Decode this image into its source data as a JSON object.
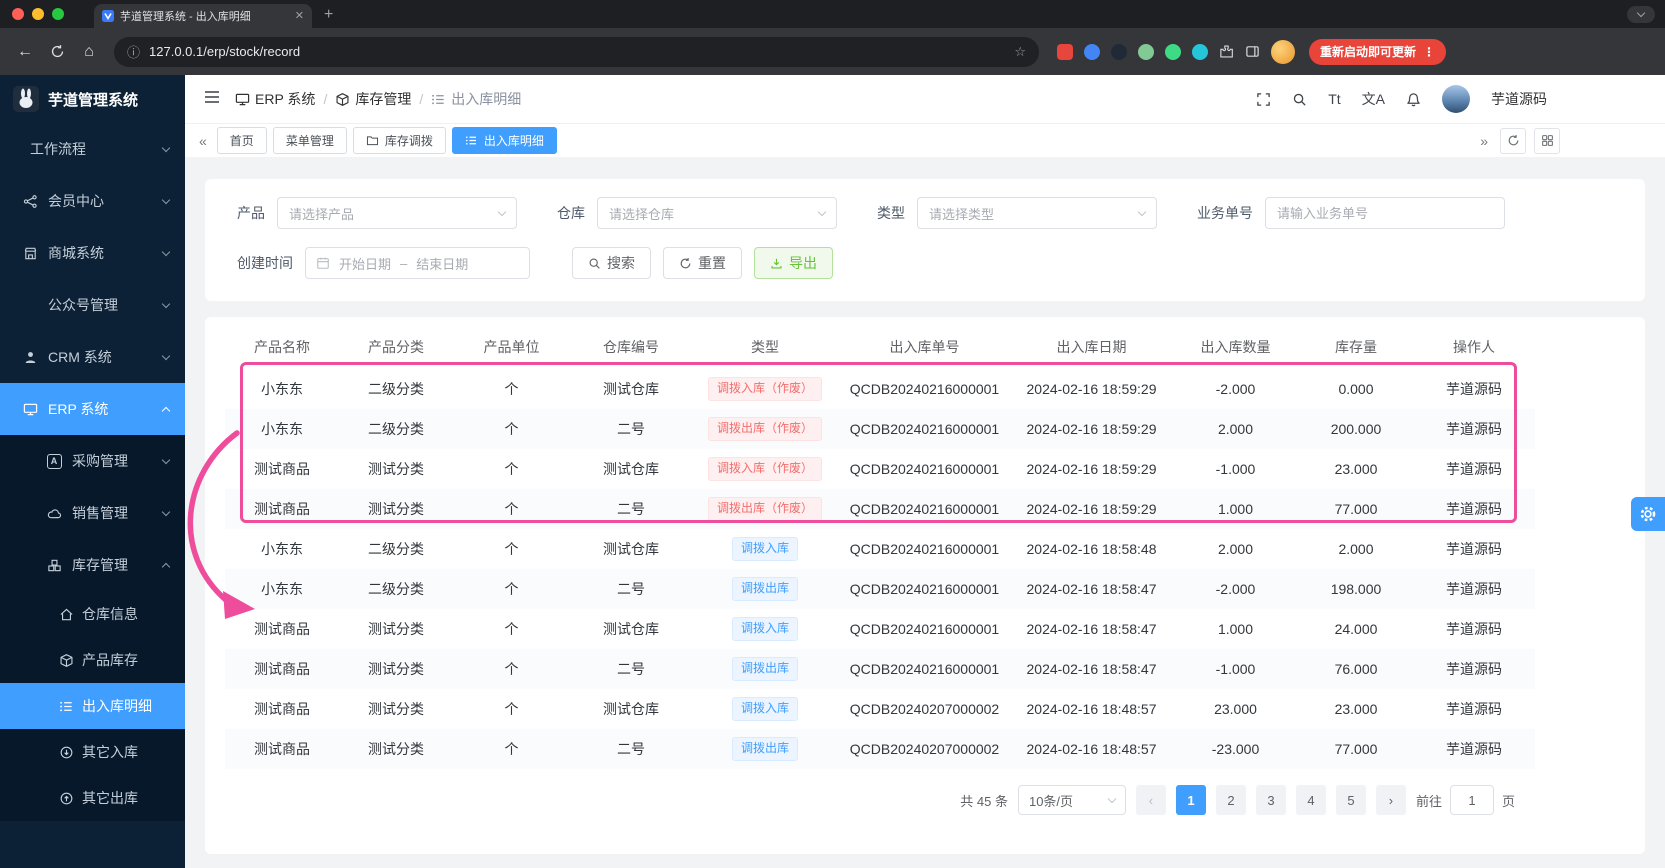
{
  "colors": {
    "primary": "#409eff",
    "danger": "#f56c6c",
    "success": "#67c23a",
    "annotation_pink": "#ee4d9b",
    "sidebar_bg": "#0c2135"
  },
  "browser": {
    "tab_title": "芋道管理系统 - 出入库明细",
    "url": "127.0.0.1/erp/stock/record",
    "update_button": "重新启动即可更新"
  },
  "icons": {
    "collapse": "«",
    "expand": "»",
    "more": "⋮",
    "close": "✕",
    "new_tab": "+",
    "back": "←",
    "home": "⌂",
    "info": "ⓘ",
    "star": "☆",
    "slash": "/",
    "purchase_a": "A"
  },
  "sidebar": {
    "app_title": "芋道管理系统",
    "items": [
      {
        "label": "工作流程"
      },
      {
        "label": "会员中心"
      },
      {
        "label": "商城系统"
      },
      {
        "label": "公众号管理"
      },
      {
        "label": "CRM 系统"
      },
      {
        "label": "ERP 系统"
      },
      {
        "label": "采购管理"
      },
      {
        "label": "销售管理"
      },
      {
        "label": "库存管理"
      },
      {
        "label": "仓库信息"
      },
      {
        "label": "产品库存"
      },
      {
        "label": "出入库明细"
      },
      {
        "label": "其它入库"
      },
      {
        "label": "其它出库"
      }
    ]
  },
  "header": {
    "breadcrumb": [
      {
        "label": "ERP 系统"
      },
      {
        "label": "库存管理"
      },
      {
        "label": "出入库明细"
      }
    ],
    "font_size_icon_text": "Tt",
    "translate_icon_text": "文A",
    "username": "芋道源码"
  },
  "tags": [
    {
      "label": "首页"
    },
    {
      "label": "菜单管理"
    },
    {
      "label": "库存调拨"
    },
    {
      "label": "出入库明细"
    }
  ],
  "filters": {
    "product_label": "产品",
    "product_placeholder": "请选择产品",
    "warehouse_label": "仓库",
    "warehouse_placeholder": "请选择仓库",
    "type_label": "类型",
    "type_placeholder": "请选择类型",
    "bizno_label": "业务单号",
    "bizno_placeholder": "请输入业务单号",
    "created_label": "创建时间",
    "date_start": "开始日期",
    "date_sep": "–",
    "date_end": "结束日期",
    "search": "搜索",
    "reset": "重置",
    "export": "导出"
  },
  "table": {
    "columns": [
      "产品名称",
      "产品分类",
      "产品单位",
      "仓库编号",
      "类型",
      "出入库单号",
      "出入库日期",
      "出入库数量",
      "库存量",
      "操作人"
    ],
    "rows": [
      {
        "product": "小东东",
        "category": "二级分类",
        "unit": "个",
        "warehouse": "测试仓库",
        "type": "调拨入库（作废）",
        "type_style": "danger",
        "order_no": "QCDB20240216000001",
        "date": "2024-02-16 18:59:29",
        "quantity": "-2.000",
        "stock": "0.000",
        "operator": "芋道源码"
      },
      {
        "product": "小东东",
        "category": "二级分类",
        "unit": "个",
        "warehouse": "二号",
        "type": "调拨出库（作废）",
        "type_style": "danger",
        "order_no": "QCDB20240216000001",
        "date": "2024-02-16 18:59:29",
        "quantity": "2.000",
        "stock": "200.000",
        "operator": "芋道源码"
      },
      {
        "product": "测试商品",
        "category": "测试分类",
        "unit": "个",
        "warehouse": "测试仓库",
        "type": "调拨入库（作废）",
        "type_style": "danger",
        "order_no": "QCDB20240216000001",
        "date": "2024-02-16 18:59:29",
        "quantity": "-1.000",
        "stock": "23.000",
        "operator": "芋道源码"
      },
      {
        "product": "测试商品",
        "category": "测试分类",
        "unit": "个",
        "warehouse": "二号",
        "type": "调拨出库（作废）",
        "type_style": "danger",
        "order_no": "QCDB20240216000001",
        "date": "2024-02-16 18:59:29",
        "quantity": "1.000",
        "stock": "77.000",
        "operator": "芋道源码"
      },
      {
        "product": "小东东",
        "category": "二级分类",
        "unit": "个",
        "warehouse": "测试仓库",
        "type": "调拨入库",
        "type_style": "primary",
        "order_no": "QCDB20240216000001",
        "date": "2024-02-16 18:58:48",
        "quantity": "2.000",
        "stock": "2.000",
        "operator": "芋道源码"
      },
      {
        "product": "小东东",
        "category": "二级分类",
        "unit": "个",
        "warehouse": "二号",
        "type": "调拨出库",
        "type_style": "primary",
        "order_no": "QCDB20240216000001",
        "date": "2024-02-16 18:58:47",
        "quantity": "-2.000",
        "stock": "198.000",
        "operator": "芋道源码"
      },
      {
        "product": "测试商品",
        "category": "测试分类",
        "unit": "个",
        "warehouse": "测试仓库",
        "type": "调拨入库",
        "type_style": "primary",
        "order_no": "QCDB20240216000001",
        "date": "2024-02-16 18:58:47",
        "quantity": "1.000",
        "stock": "24.000",
        "operator": "芋道源码"
      },
      {
        "product": "测试商品",
        "category": "测试分类",
        "unit": "个",
        "warehouse": "二号",
        "type": "调拨出库",
        "type_style": "primary",
        "order_no": "QCDB20240216000001",
        "date": "2024-02-16 18:58:47",
        "quantity": "-1.000",
        "stock": "76.000",
        "operator": "芋道源码"
      },
      {
        "product": "测试商品",
        "category": "测试分类",
        "unit": "个",
        "warehouse": "测试仓库",
        "type": "调拨入库",
        "type_style": "primary",
        "order_no": "QCDB20240207000002",
        "date": "2024-02-16 18:48:57",
        "quantity": "23.000",
        "stock": "23.000",
        "operator": "芋道源码"
      },
      {
        "product": "测试商品",
        "category": "测试分类",
        "unit": "个",
        "warehouse": "二号",
        "type": "调拨出库",
        "type_style": "primary",
        "order_no": "QCDB20240207000002",
        "date": "2024-02-16 18:48:57",
        "quantity": "-23.000",
        "stock": "77.000",
        "operator": "芋道源码"
      }
    ]
  },
  "pagination": {
    "total": "共 45 条",
    "page_size": "10条/页",
    "prev": "‹",
    "next": "›",
    "pages": [
      "1",
      "2",
      "3",
      "4",
      "5"
    ],
    "goto_label": "前往",
    "goto_value": "1",
    "goto_unit": "页"
  }
}
